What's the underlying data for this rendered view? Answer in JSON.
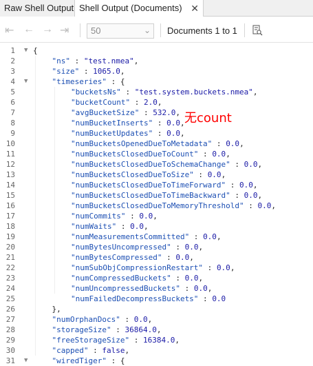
{
  "tabs": [
    {
      "label": "Raw Shell Output",
      "active": false
    },
    {
      "label": "Shell Output (Documents)",
      "active": true
    }
  ],
  "toolbar": {
    "page_size": "50",
    "documents_label": "Documents 1 to 1"
  },
  "annotation": "无count",
  "lines": [
    {
      "n": "1",
      "indent": 0,
      "fold": true,
      "parts": [
        [
          "p",
          "{"
        ]
      ]
    },
    {
      "n": "2",
      "indent": 1,
      "fold": false,
      "parts": [
        [
          "k",
          "\"ns\""
        ],
        [
          "p",
          " : "
        ],
        [
          "s",
          "\"test.nmea\""
        ],
        [
          "p",
          ","
        ]
      ]
    },
    {
      "n": "3",
      "indent": 1,
      "fold": false,
      "parts": [
        [
          "k",
          "\"size\""
        ],
        [
          "p",
          " : "
        ],
        [
          "s",
          "1065.0"
        ],
        [
          "p",
          ","
        ]
      ]
    },
    {
      "n": "4",
      "indent": 1,
      "fold": true,
      "parts": [
        [
          "k",
          "\"timeseries\""
        ],
        [
          "p",
          " : {"
        ]
      ]
    },
    {
      "n": "5",
      "indent": 2,
      "fold": false,
      "parts": [
        [
          "k",
          "\"bucketsNs\""
        ],
        [
          "p",
          " : "
        ],
        [
          "s",
          "\"test.system.buckets.nmea\""
        ],
        [
          "p",
          ","
        ]
      ]
    },
    {
      "n": "6",
      "indent": 2,
      "fold": false,
      "parts": [
        [
          "k",
          "\"bucketCount\""
        ],
        [
          "p",
          " : "
        ],
        [
          "s",
          "2.0"
        ],
        [
          "p",
          ","
        ]
      ]
    },
    {
      "n": "7",
      "indent": 2,
      "fold": false,
      "parts": [
        [
          "k",
          "\"avgBucketSize\""
        ],
        [
          "p",
          " : "
        ],
        [
          "s",
          "532.0"
        ],
        [
          "p",
          ","
        ]
      ]
    },
    {
      "n": "8",
      "indent": 2,
      "fold": false,
      "parts": [
        [
          "k",
          "\"numBucketInserts\""
        ],
        [
          "p",
          " : "
        ],
        [
          "s",
          "0.0"
        ],
        [
          "p",
          ","
        ]
      ]
    },
    {
      "n": "9",
      "indent": 2,
      "fold": false,
      "parts": [
        [
          "k",
          "\"numBucketUpdates\""
        ],
        [
          "p",
          " : "
        ],
        [
          "s",
          "0.0"
        ],
        [
          "p",
          ","
        ]
      ]
    },
    {
      "n": "10",
      "indent": 2,
      "fold": false,
      "parts": [
        [
          "k",
          "\"numBucketsOpenedDueToMetadata\""
        ],
        [
          "p",
          " : "
        ],
        [
          "s",
          "0.0"
        ],
        [
          "p",
          ","
        ]
      ]
    },
    {
      "n": "11",
      "indent": 2,
      "fold": false,
      "parts": [
        [
          "k",
          "\"numBucketsClosedDueToCount\""
        ],
        [
          "p",
          " : "
        ],
        [
          "s",
          "0.0"
        ],
        [
          "p",
          ","
        ]
      ]
    },
    {
      "n": "12",
      "indent": 2,
      "fold": false,
      "parts": [
        [
          "k",
          "\"numBucketsClosedDueToSchemaChange\""
        ],
        [
          "p",
          " : "
        ],
        [
          "s",
          "0.0"
        ],
        [
          "p",
          ","
        ]
      ]
    },
    {
      "n": "13",
      "indent": 2,
      "fold": false,
      "parts": [
        [
          "k",
          "\"numBucketsClosedDueToSize\""
        ],
        [
          "p",
          " : "
        ],
        [
          "s",
          "0.0"
        ],
        [
          "p",
          ","
        ]
      ]
    },
    {
      "n": "14",
      "indent": 2,
      "fold": false,
      "parts": [
        [
          "k",
          "\"numBucketsClosedDueToTimeForward\""
        ],
        [
          "p",
          " : "
        ],
        [
          "s",
          "0.0"
        ],
        [
          "p",
          ","
        ]
      ]
    },
    {
      "n": "15",
      "indent": 2,
      "fold": false,
      "parts": [
        [
          "k",
          "\"numBucketsClosedDueToTimeBackward\""
        ],
        [
          "p",
          " : "
        ],
        [
          "s",
          "0.0"
        ],
        [
          "p",
          ","
        ]
      ]
    },
    {
      "n": "16",
      "indent": 2,
      "fold": false,
      "parts": [
        [
          "k",
          "\"numBucketsClosedDueToMemoryThreshold\""
        ],
        [
          "p",
          " : "
        ],
        [
          "s",
          "0.0"
        ],
        [
          "p",
          ","
        ]
      ]
    },
    {
      "n": "17",
      "indent": 2,
      "fold": false,
      "parts": [
        [
          "k",
          "\"numCommits\""
        ],
        [
          "p",
          " : "
        ],
        [
          "s",
          "0.0"
        ],
        [
          "p",
          ","
        ]
      ]
    },
    {
      "n": "18",
      "indent": 2,
      "fold": false,
      "parts": [
        [
          "k",
          "\"numWaits\""
        ],
        [
          "p",
          " : "
        ],
        [
          "s",
          "0.0"
        ],
        [
          "p",
          ","
        ]
      ]
    },
    {
      "n": "19",
      "indent": 2,
      "fold": false,
      "parts": [
        [
          "k",
          "\"numMeasurementsCommitted\""
        ],
        [
          "p",
          " : "
        ],
        [
          "s",
          "0.0"
        ],
        [
          "p",
          ","
        ]
      ]
    },
    {
      "n": "20",
      "indent": 2,
      "fold": false,
      "parts": [
        [
          "k",
          "\"numBytesUncompressed\""
        ],
        [
          "p",
          " : "
        ],
        [
          "s",
          "0.0"
        ],
        [
          "p",
          ","
        ]
      ]
    },
    {
      "n": "21",
      "indent": 2,
      "fold": false,
      "parts": [
        [
          "k",
          "\"numBytesCompressed\""
        ],
        [
          "p",
          " : "
        ],
        [
          "s",
          "0.0"
        ],
        [
          "p",
          ","
        ]
      ]
    },
    {
      "n": "22",
      "indent": 2,
      "fold": false,
      "parts": [
        [
          "k",
          "\"numSubObjCompressionRestart\""
        ],
        [
          "p",
          " : "
        ],
        [
          "s",
          "0.0"
        ],
        [
          "p",
          ","
        ]
      ]
    },
    {
      "n": "23",
      "indent": 2,
      "fold": false,
      "parts": [
        [
          "k",
          "\"numCompressedBuckets\""
        ],
        [
          "p",
          " : "
        ],
        [
          "s",
          "0.0"
        ],
        [
          "p",
          ","
        ]
      ]
    },
    {
      "n": "24",
      "indent": 2,
      "fold": false,
      "parts": [
        [
          "k",
          "\"numUncompressedBuckets\""
        ],
        [
          "p",
          " : "
        ],
        [
          "s",
          "0.0"
        ],
        [
          "p",
          ","
        ]
      ]
    },
    {
      "n": "25",
      "indent": 2,
      "fold": false,
      "parts": [
        [
          "k",
          "\"numFailedDecompressBuckets\""
        ],
        [
          "p",
          " : "
        ],
        [
          "s",
          "0.0"
        ]
      ]
    },
    {
      "n": "26",
      "indent": 1,
      "fold": false,
      "parts": [
        [
          "p",
          "},"
        ]
      ]
    },
    {
      "n": "27",
      "indent": 1,
      "fold": false,
      "parts": [
        [
          "k",
          "\"numOrphanDocs\""
        ],
        [
          "p",
          " : "
        ],
        [
          "s",
          "0.0"
        ],
        [
          "p",
          ","
        ]
      ]
    },
    {
      "n": "28",
      "indent": 1,
      "fold": false,
      "parts": [
        [
          "k",
          "\"storageSize\""
        ],
        [
          "p",
          " : "
        ],
        [
          "s",
          "36864.0"
        ],
        [
          "p",
          ","
        ]
      ]
    },
    {
      "n": "29",
      "indent": 1,
      "fold": false,
      "parts": [
        [
          "k",
          "\"freeStorageSize\""
        ],
        [
          "p",
          " : "
        ],
        [
          "s",
          "16384.0"
        ],
        [
          "p",
          ","
        ]
      ]
    },
    {
      "n": "30",
      "indent": 1,
      "fold": false,
      "parts": [
        [
          "k",
          "\"capped\""
        ],
        [
          "p",
          " : "
        ],
        [
          "s",
          "false"
        ],
        [
          "p",
          ","
        ]
      ]
    },
    {
      "n": "31",
      "indent": 1,
      "fold": true,
      "parts": [
        [
          "k",
          "\"wiredTiger\""
        ],
        [
          "p",
          " : {"
        ]
      ]
    }
  ]
}
